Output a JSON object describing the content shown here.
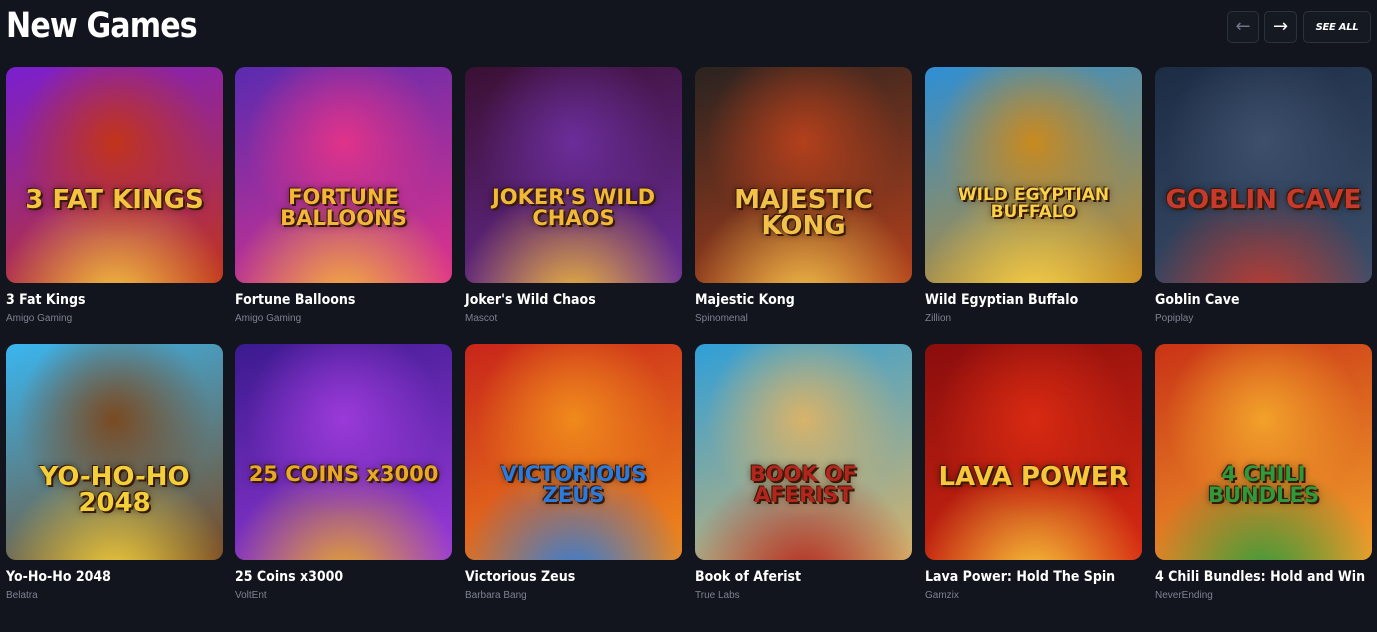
{
  "section": {
    "title": "New Games",
    "prev_icon": "arrow-left-icon",
    "next_icon": "arrow-right-icon",
    "see_all_label": "SEE ALL"
  },
  "games": [
    {
      "name": "3 Fat Kings",
      "provider": "Amigo Gaming",
      "logo": "3 FAT KINGS",
      "colors": [
        "#7a1fd1",
        "#c2341a",
        "#f5c542"
      ]
    },
    {
      "name": "Fortune Balloons",
      "provider": "Amigo Gaming",
      "logo": "FORTUNE BALLOONS",
      "colors": [
        "#5a2bb0",
        "#e0338a",
        "#f3b53a"
      ]
    },
    {
      "name": "Joker's Wild Chaos",
      "provider": "Mascot",
      "logo": "JOKER'S WILD CHAOS",
      "colors": [
        "#3a1033",
        "#6b2d9a",
        "#f0b93a"
      ]
    },
    {
      "name": "Majestic Kong",
      "provider": "Spinomenal",
      "logo": "MAJESTIC KONG",
      "colors": [
        "#2a2320",
        "#b3401c",
        "#f2c14a"
      ]
    },
    {
      "name": "Wild Egyptian Buffalo",
      "provider": "Zillion",
      "logo": "WILD EGYPTIAN BUFFALO",
      "colors": [
        "#2d8fd6",
        "#c98a1f",
        "#f7d24a"
      ]
    },
    {
      "name": "Goblin Cave",
      "provider": "Popiplay",
      "logo": "GOBLIN CAVE",
      "colors": [
        "#1c2c45",
        "#3d4f6b",
        "#c63a2e"
      ]
    },
    {
      "name": "Yo-Ho-Ho 2048",
      "provider": "Belatra",
      "logo": "YO-HO-HO 2048",
      "colors": [
        "#3ab6f0",
        "#7a4a22",
        "#f3d03a"
      ]
    },
    {
      "name": "25 Coins x3000",
      "provider": "VoltEnt",
      "logo": "25 COINS x3000",
      "colors": [
        "#3b1a8f",
        "#9b3ad9",
        "#e8a928"
      ]
    },
    {
      "name": "Victorious Zeus",
      "provider": "Barbara Bang",
      "logo": "VICTORIOUS ZEUS",
      "colors": [
        "#c8251a",
        "#f08a1c",
        "#2a7be0"
      ]
    },
    {
      "name": "Book of Aferist",
      "provider": "True Labs",
      "logo": "BOOK OF AFERIST",
      "colors": [
        "#2f9fd8",
        "#d8b36a",
        "#b3261e"
      ]
    },
    {
      "name": "Lava Power: Hold The Spin",
      "provider": "Gamzix",
      "logo": "LAVA POWER",
      "colors": [
        "#8a0d0d",
        "#d82a12",
        "#f7c63a"
      ]
    },
    {
      "name": "4 Chili Bundles: Hold and Win",
      "provider": "NeverEnding",
      "logo": "4 CHILI BUNDLES",
      "colors": [
        "#c93316",
        "#f2a12b",
        "#2f9a3c"
      ]
    }
  ]
}
